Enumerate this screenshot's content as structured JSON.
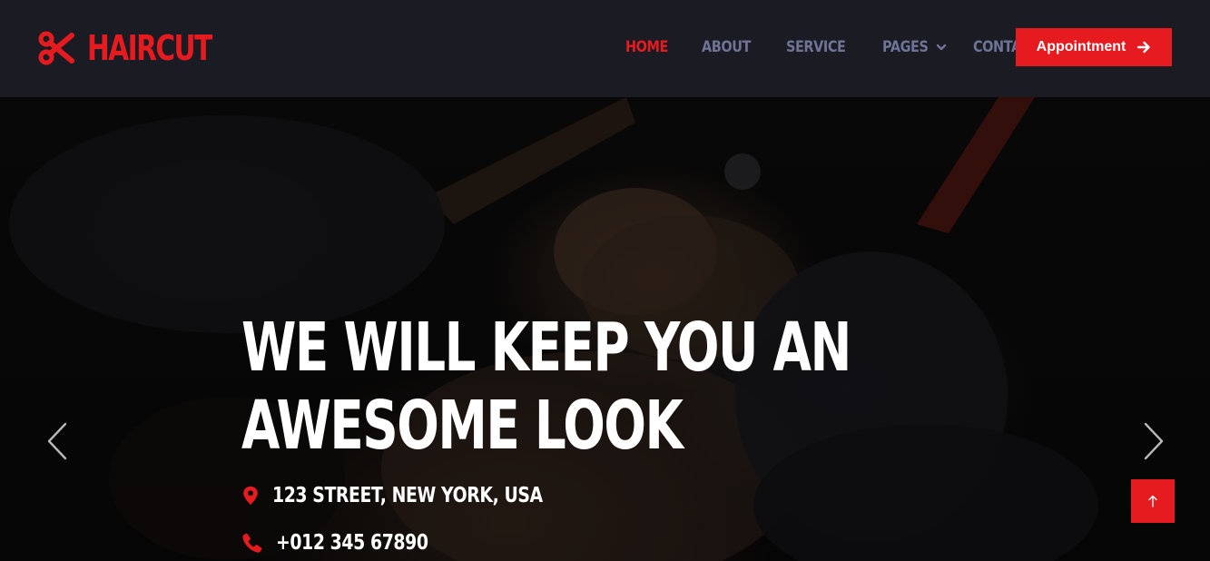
{
  "brand": {
    "name": "HAIRCUT",
    "icon": "scissors-icon"
  },
  "nav": {
    "items": [
      {
        "label": "HOME",
        "active": true
      },
      {
        "label": "ABOUT",
        "active": false
      },
      {
        "label": "SERVICE",
        "active": false
      },
      {
        "label": "PAGES",
        "active": false,
        "dropdown": true
      },
      {
        "label": "CONTACT",
        "active": false
      }
    ],
    "cta": {
      "label": "Appointment",
      "icon": "arrow-right-icon"
    }
  },
  "hero": {
    "headline_line1": "WE WILL KEEP YOU AN",
    "headline_line2": "AWESOME LOOK",
    "address": "123 STREET, NEW YORK, USA",
    "address_icon": "map-marker-icon",
    "phone": "+012 345 67890",
    "phone_icon": "phone-icon"
  },
  "controls": {
    "prev_icon": "chevron-left-icon",
    "next_icon": "chevron-right-icon",
    "back_to_top_icon": "arrow-up-icon"
  },
  "colors": {
    "accent": "#e51b1f",
    "navbar_bg": "#1a1b23",
    "nav_text": "#6f7396",
    "hero_text": "#ffffff"
  }
}
